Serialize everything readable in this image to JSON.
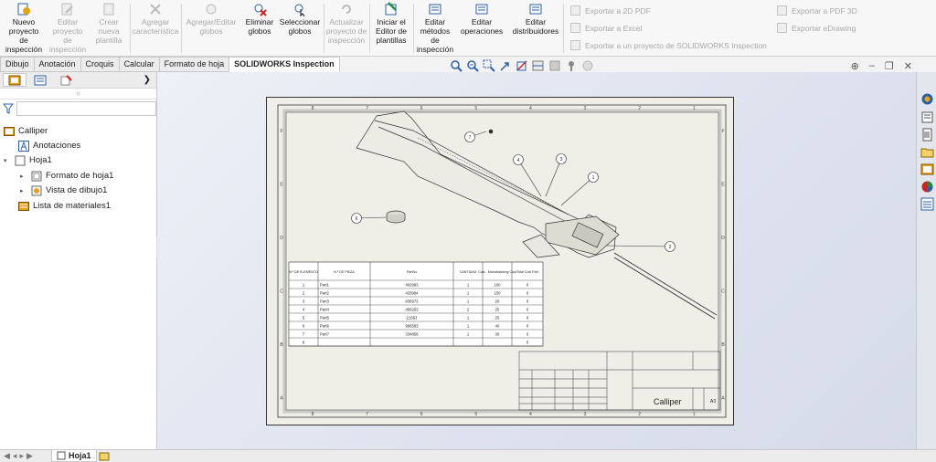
{
  "ribbon": {
    "buttons": [
      {
        "label": "Nuevo proyecto de inspección",
        "enabled": true
      },
      {
        "label": "Editar proyecto de inspección",
        "enabled": false
      },
      {
        "label": "Crear nueva plantilla",
        "enabled": false
      },
      {
        "label": "Agregar característica",
        "enabled": false
      },
      {
        "label": "Agregar/Editar globos",
        "enabled": false
      },
      {
        "label": "Eliminar globos",
        "enabled": true
      },
      {
        "label": "Seleccionar globos",
        "enabled": true
      },
      {
        "label": "Actualizar proyecto de inspección",
        "enabled": false
      },
      {
        "label": "Iniciar el Editor de plantillas",
        "enabled": true
      },
      {
        "label": "Editar métodos de inspección",
        "enabled": true
      },
      {
        "label": "Editar operaciones",
        "enabled": true
      },
      {
        "label": "Editar distribuidores",
        "enabled": true
      }
    ],
    "exports": [
      "Exportar a 2D PDF",
      "Exportar a Excel",
      "Exportar a un proyecto de SOLIDWORKS Inspection",
      "Exportar a PDF 3D",
      "Exportar eDrawing"
    ]
  },
  "tabs": [
    "Dibujo",
    "Anotación",
    "Croquis",
    "Calcular",
    "Formato de hoja",
    "SOLIDWORKS Inspection"
  ],
  "active_tab": "SOLIDWORKS Inspection",
  "tree": {
    "root": "Calliper",
    "items": [
      "Anotaciones",
      "Hoja1",
      "Formato de hoja1",
      "Vista de dibujo1",
      "Lista de materiales1"
    ]
  },
  "drawing": {
    "col_labels": [
      "8",
      "7",
      "6",
      "5",
      "4",
      "3",
      "2",
      "1"
    ],
    "row_labels": [
      "F",
      "E",
      "D",
      "C",
      "B",
      "A"
    ],
    "balloons": [
      "7",
      "4",
      "3",
      "1",
      "6",
      "2"
    ],
    "bom": {
      "headers": [
        "N.º DE ELEMENTO",
        "N.º DE PIEZA",
        "PartNo",
        "CANTIDAD",
        "Cost - Manufacturing Cost",
        "Total Cost Part"
      ],
      "rows": [
        [
          "1",
          "Part1",
          "402963",
          "1",
          "100",
          "0"
        ],
        [
          "2",
          "Part2",
          "433994",
          "1",
          "150",
          "0"
        ],
        [
          "3",
          "Part3",
          "836973",
          "1",
          "20",
          "0"
        ],
        [
          "4",
          "Part4",
          "458253",
          "2",
          "25",
          "0"
        ],
        [
          "5",
          "Part5",
          "21563",
          "1",
          "25",
          "0"
        ],
        [
          "6",
          "Part6",
          "966583",
          "1",
          "40",
          "0"
        ],
        [
          "7",
          "Part7",
          "334856",
          "1",
          "30",
          "0"
        ],
        [
          "8",
          "",
          "",
          "",
          "",
          "0"
        ]
      ]
    },
    "title_block": {
      "name": "Calliper",
      "size": "A3"
    }
  },
  "status": {
    "sheet_tab": "Hoja1"
  }
}
